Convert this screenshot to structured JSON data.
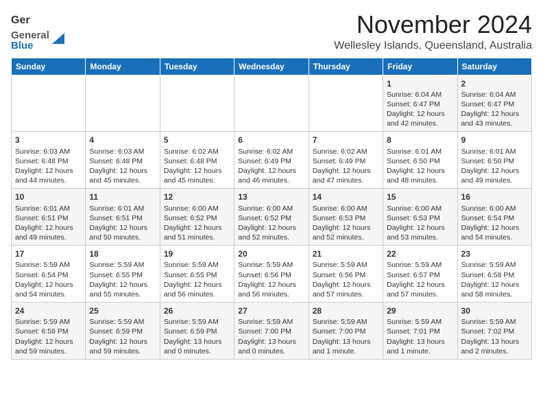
{
  "header": {
    "logo_general": "General",
    "logo_blue": "Blue",
    "month_title": "November 2024",
    "subtitle": "Wellesley Islands, Queensland, Australia"
  },
  "days_of_week": [
    "Sunday",
    "Monday",
    "Tuesday",
    "Wednesday",
    "Thursday",
    "Friday",
    "Saturday"
  ],
  "weeks": [
    {
      "row": 1,
      "cells": [
        {
          "day": "",
          "content": ""
        },
        {
          "day": "",
          "content": ""
        },
        {
          "day": "",
          "content": ""
        },
        {
          "day": "",
          "content": ""
        },
        {
          "day": "",
          "content": ""
        },
        {
          "day": "1",
          "content": "Sunrise: 6:04 AM\nSunset: 6:47 PM\nDaylight: 12 hours\nand 42 minutes."
        },
        {
          "day": "2",
          "content": "Sunrise: 6:04 AM\nSunset: 6:47 PM\nDaylight: 12 hours\nand 43 minutes."
        }
      ]
    },
    {
      "row": 2,
      "cells": [
        {
          "day": "3",
          "content": "Sunrise: 6:03 AM\nSunset: 6:48 PM\nDaylight: 12 hours\nand 44 minutes."
        },
        {
          "day": "4",
          "content": "Sunrise: 6:03 AM\nSunset: 6:48 PM\nDaylight: 12 hours\nand 45 minutes."
        },
        {
          "day": "5",
          "content": "Sunrise: 6:02 AM\nSunset: 6:48 PM\nDaylight: 12 hours\nand 45 minutes."
        },
        {
          "day": "6",
          "content": "Sunrise: 6:02 AM\nSunset: 6:49 PM\nDaylight: 12 hours\nand 46 minutes."
        },
        {
          "day": "7",
          "content": "Sunrise: 6:02 AM\nSunset: 6:49 PM\nDaylight: 12 hours\nand 47 minutes."
        },
        {
          "day": "8",
          "content": "Sunrise: 6:01 AM\nSunset: 6:50 PM\nDaylight: 12 hours\nand 48 minutes."
        },
        {
          "day": "9",
          "content": "Sunrise: 6:01 AM\nSunset: 6:50 PM\nDaylight: 12 hours\nand 49 minutes."
        }
      ]
    },
    {
      "row": 3,
      "cells": [
        {
          "day": "10",
          "content": "Sunrise: 6:01 AM\nSunset: 6:51 PM\nDaylight: 12 hours\nand 49 minutes."
        },
        {
          "day": "11",
          "content": "Sunrise: 6:01 AM\nSunset: 6:51 PM\nDaylight: 12 hours\nand 50 minutes."
        },
        {
          "day": "12",
          "content": "Sunrise: 6:00 AM\nSunset: 6:52 PM\nDaylight: 12 hours\nand 51 minutes."
        },
        {
          "day": "13",
          "content": "Sunrise: 6:00 AM\nSunset: 6:52 PM\nDaylight: 12 hours\nand 52 minutes."
        },
        {
          "day": "14",
          "content": "Sunrise: 6:00 AM\nSunset: 6:53 PM\nDaylight: 12 hours\nand 52 minutes."
        },
        {
          "day": "15",
          "content": "Sunrise: 6:00 AM\nSunset: 6:53 PM\nDaylight: 12 hours\nand 53 minutes."
        },
        {
          "day": "16",
          "content": "Sunrise: 6:00 AM\nSunset: 6:54 PM\nDaylight: 12 hours\nand 54 minutes."
        }
      ]
    },
    {
      "row": 4,
      "cells": [
        {
          "day": "17",
          "content": "Sunrise: 5:59 AM\nSunset: 6:54 PM\nDaylight: 12 hours\nand 54 minutes."
        },
        {
          "day": "18",
          "content": "Sunrise: 5:59 AM\nSunset: 6:55 PM\nDaylight: 12 hours\nand 55 minutes."
        },
        {
          "day": "19",
          "content": "Sunrise: 5:59 AM\nSunset: 6:55 PM\nDaylight: 12 hours\nand 56 minutes."
        },
        {
          "day": "20",
          "content": "Sunrise: 5:59 AM\nSunset: 6:56 PM\nDaylight: 12 hours\nand 56 minutes."
        },
        {
          "day": "21",
          "content": "Sunrise: 5:59 AM\nSunset: 6:56 PM\nDaylight: 12 hours\nand 57 minutes."
        },
        {
          "day": "22",
          "content": "Sunrise: 5:59 AM\nSunset: 6:57 PM\nDaylight: 12 hours\nand 57 minutes."
        },
        {
          "day": "23",
          "content": "Sunrise: 5:59 AM\nSunset: 6:58 PM\nDaylight: 12 hours\nand 58 minutes."
        }
      ]
    },
    {
      "row": 5,
      "cells": [
        {
          "day": "24",
          "content": "Sunrise: 5:59 AM\nSunset: 6:58 PM\nDaylight: 12 hours\nand 59 minutes."
        },
        {
          "day": "25",
          "content": "Sunrise: 5:59 AM\nSunset: 6:59 PM\nDaylight: 12 hours\nand 59 minutes."
        },
        {
          "day": "26",
          "content": "Sunrise: 5:59 AM\nSunset: 6:59 PM\nDaylight: 13 hours\nand 0 minutes."
        },
        {
          "day": "27",
          "content": "Sunrise: 5:59 AM\nSunset: 7:00 PM\nDaylight: 13 hours\nand 0 minutes."
        },
        {
          "day": "28",
          "content": "Sunrise: 5:59 AM\nSunset: 7:00 PM\nDaylight: 13 hours\nand 1 minute."
        },
        {
          "day": "29",
          "content": "Sunrise: 5:59 AM\nSunset: 7:01 PM\nDaylight: 13 hours\nand 1 minute."
        },
        {
          "day": "30",
          "content": "Sunrise: 5:59 AM\nSunset: 7:02 PM\nDaylight: 13 hours\nand 2 minutes."
        }
      ]
    }
  ]
}
